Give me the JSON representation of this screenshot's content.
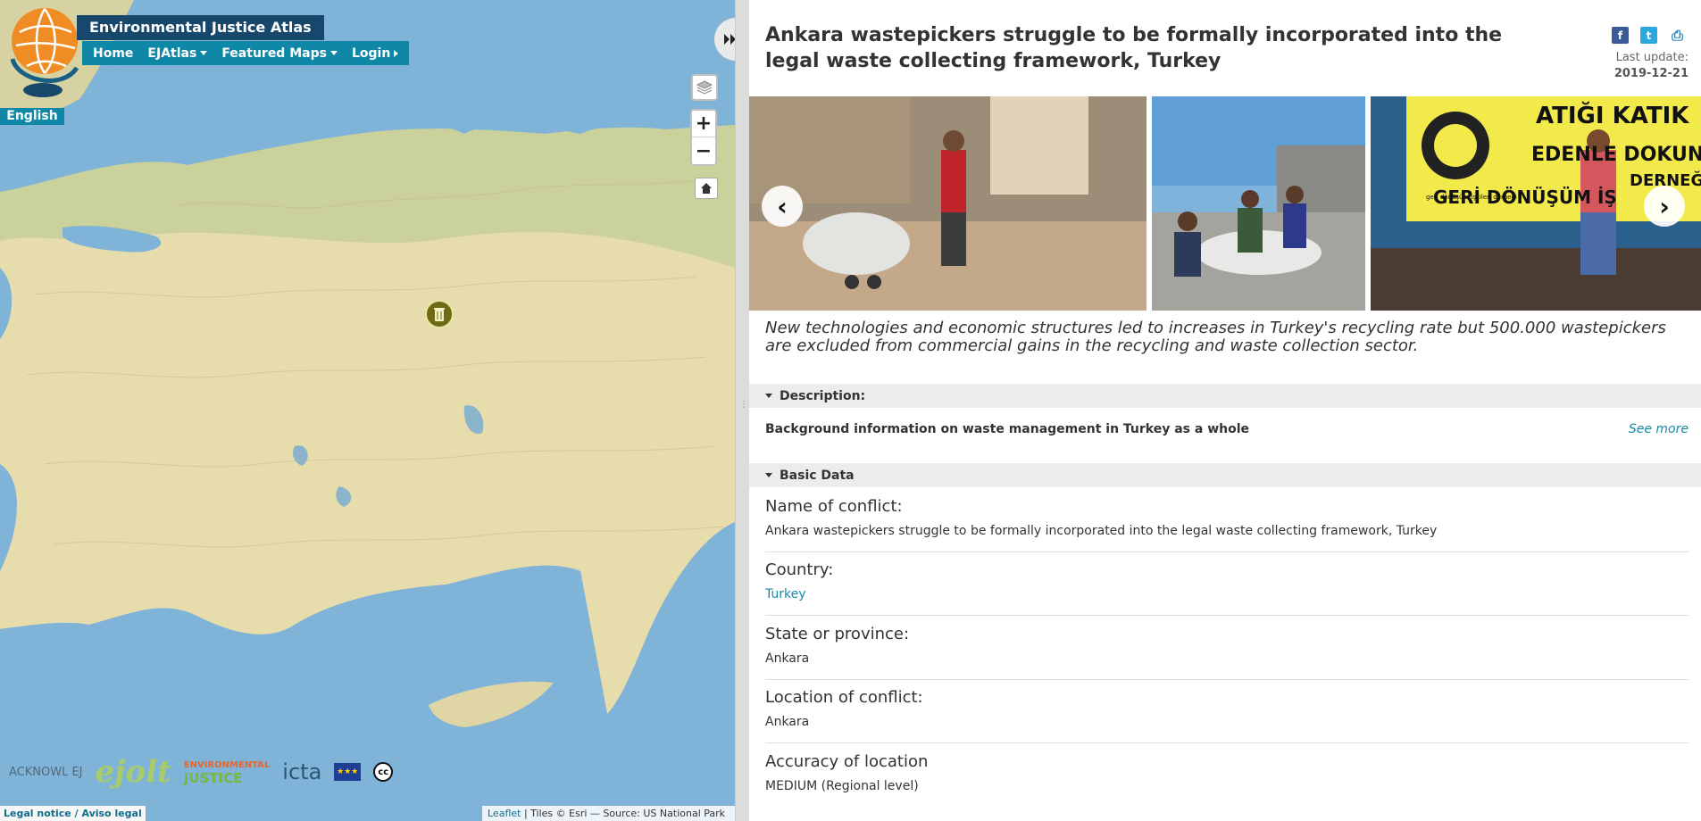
{
  "header": {
    "site_title": "Environmental Justice Atlas",
    "nav": [
      {
        "label": "Home"
      },
      {
        "label": "EJAtlas"
      },
      {
        "label": "Featured Maps"
      },
      {
        "label": "Login"
      }
    ],
    "language": "English"
  },
  "map": {
    "zoom_in": "+",
    "zoom_out": "−",
    "legal": "Legal notice / Aviso legal",
    "attribution_leaflet": "Leaflet",
    "attribution_rest": "| Tiles © Esri — Source: US National Park Service",
    "partner_logos": {
      "acknowlej": "ACKNOWL EJ",
      "ejolt": "ejolt",
      "ej_line1": "ENVIRONMENTAL",
      "ej_line2": "JUSTICE",
      "icta": "icta",
      "cc": "cc"
    }
  },
  "article": {
    "title": "Ankara wastepickers struggle to be formally incorporated into the legal waste collecting framework, Turkey",
    "last_update_label": "Last update:",
    "last_update": "2019-12-21",
    "social": {
      "facebook": "f",
      "twitter": "t",
      "print": "⎙"
    },
    "summary": "New technologies and economic structures led to increases in Turkey's recycling rate but 500.000 wastepickers are excluded from commercial gains in the recycling and waste collection sector.",
    "description_heading": "Description:",
    "description_text": "Background information on waste management in Turkey as a whole",
    "see_more": "See more",
    "basic_data_heading": "Basic Data",
    "fields": [
      {
        "label": "Name of conflict:",
        "value": "Ankara wastepickers struggle to be formally incorporated into the legal waste collecting framework, Turkey"
      },
      {
        "label": "Country:",
        "value": "Turkey"
      },
      {
        "label": "State or province:",
        "value": "Ankara"
      },
      {
        "label": "Location of conflict:",
        "value": "Ankara"
      },
      {
        "label": "Accuracy of location",
        "value": "MEDIUM (Regional level)"
      }
    ]
  },
  "gallery": {
    "photo3_banner_l1": "ATIĞI KATIK",
    "photo3_banner_l2": "EDENLE DOKUNMA",
    "photo3_banner_l3": "GERİ DÖNÜŞÜM İŞ",
    "photo3_banner_l4": "DERNEĞİ",
    "photo3_logo_text": "geri dönüşüm işçileri derneği"
  }
}
